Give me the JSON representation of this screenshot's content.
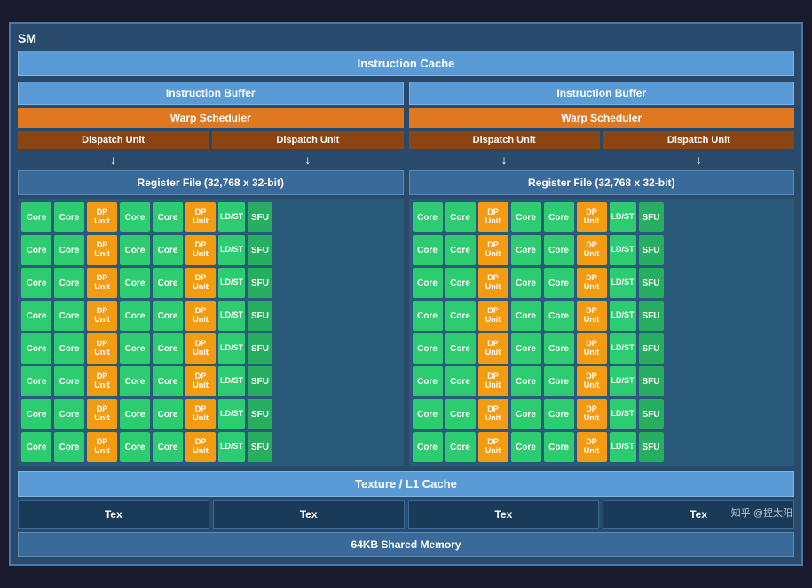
{
  "title": "SM",
  "instruction_cache": "Instruction Cache",
  "left_half": {
    "instr_buffer": "Instruction Buffer",
    "warp_scheduler": "Warp Scheduler",
    "dispatch1": "Dispatch Unit",
    "dispatch2": "Dispatch Unit",
    "register_file": "Register File (32,768 x 32-bit)"
  },
  "right_half": {
    "instr_buffer": "Instruction Buffer",
    "warp_scheduler": "Warp Scheduler",
    "dispatch1": "Dispatch Unit",
    "dispatch2": "Dispatch Unit",
    "register_file": "Register File (32,768 x 32-bit)"
  },
  "cells": {
    "core": "Core",
    "dp_unit": "DP\nUnit",
    "ldst": "LD/ST",
    "sfu": "SFU"
  },
  "texture_cache": "Texture / L1 Cache",
  "tex": "Tex",
  "shared_memory": "64KB Shared Memory",
  "watermark": "知乎 @捏太阳",
  "rows": 8
}
